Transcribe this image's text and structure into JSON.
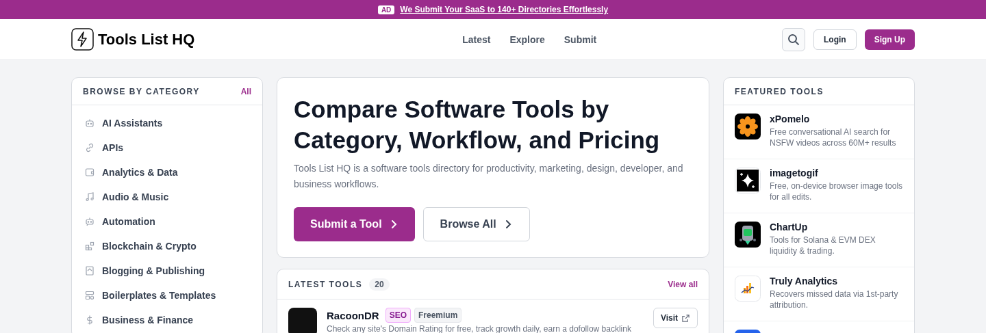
{
  "ad_bar": {
    "badge": "AD",
    "link": "We Submit Your SaaS to 140+ Directories Effortlessly"
  },
  "header": {
    "logo": "Tools List HQ",
    "nav": [
      "Latest",
      "Explore",
      "Submit"
    ],
    "login": "Login",
    "signup": "Sign Up"
  },
  "categories": {
    "title": "BROWSE BY CATEGORY",
    "all_link": "All",
    "items": [
      {
        "label": "AI Assistants"
      },
      {
        "label": "APIs"
      },
      {
        "label": "Analytics & Data"
      },
      {
        "label": "Audio & Music"
      },
      {
        "label": "Automation"
      },
      {
        "label": "Blockchain & Crypto"
      },
      {
        "label": "Blogging & Publishing"
      },
      {
        "label": "Boilerplates & Templates"
      },
      {
        "label": "Business & Finance"
      }
    ]
  },
  "hero": {
    "title": "Compare Software Tools by Category, Workflow, and Pricing",
    "description": "Tools List HQ is a software tools directory for productivity, marketing, design, developer, and business workflows.",
    "primary_button": "Submit a Tool",
    "secondary_button": "Browse All"
  },
  "latest_tools": {
    "title": "LATEST TOOLS",
    "count": "20",
    "view_all": "View all",
    "items": [
      {
        "name": "RacoonDR",
        "tags": [
          {
            "label": "SEO",
            "kind": "category"
          },
          {
            "label": "Freemium",
            "kind": "pricing"
          }
        ],
        "description": "Check any site's Domain Rating for free, track growth daily, earn a dofollow backlink",
        "visit": "Visit"
      }
    ]
  },
  "featured_tools": {
    "title": "FEATURED TOOLS",
    "items": [
      {
        "name": "xPomelo",
        "description": "Free conversational AI search for NSFW videos across 60M+ results"
      },
      {
        "name": "imagetogif",
        "description": "Free, on-device browser image tools for all edits."
      },
      {
        "name": "ChartUp",
        "description": "Tools for Solana & EVM DEX liquidity & trading."
      },
      {
        "name": "Truly Analytics",
        "description": "Recovers missed data via 1st-party attribution."
      }
    ]
  }
}
